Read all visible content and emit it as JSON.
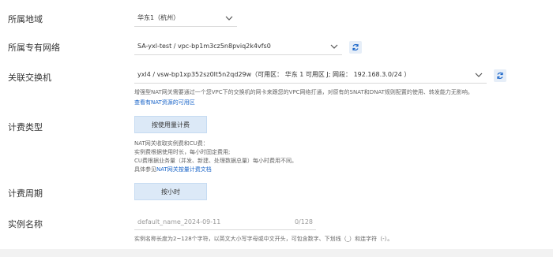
{
  "region": {
    "label": "所属地域",
    "value": "华东1（杭州）"
  },
  "vpc": {
    "label": "所属专有网络",
    "value": "SA-yxl-test / vpc-bp1m3cz5n8pviq2k4vfs0"
  },
  "vswitch": {
    "label": "关联交换机",
    "value": "yxl4 / vsw-bp1xp352sz0lt5n2qd29w（可用区： 华东 1 可用区 J; 网段： 192.168.3.0/24 ）",
    "help_line1": "增强型NAT网关需要通过一个您VPC下的交换机的网卡来跟您的VPC网络打通，对原有的SNAT和DNAT规则配置的使用、转发能力无影响。",
    "help_link": "查看有NAT资源的可用区"
  },
  "billing_type": {
    "label": "计费类型",
    "button": "按使用量计费",
    "help_line1": "NAT网关收取实例费和CU费：",
    "help_line2": "实例费根据使用时长，每小时固定费用;",
    "help_line3": "CU费根据业务量（并发、新建、处理数据总量）每小时费用不同。",
    "help_line4_prefix": "具体参见",
    "help_line4_link": "NAT网关按量计费文档"
  },
  "billing_period": {
    "label": "计费周期",
    "button": "按小时"
  },
  "instance_name": {
    "label": "实例名称",
    "placeholder": "default_name_2024-09-11",
    "counter": "0/128",
    "help": "实例名称长度为2~128个字符，以英文大小写字母或中文开头，可包含数字、下划线（_）和连字符（-）。"
  },
  "icons": {
    "chevron": "chevron-down-icon",
    "refresh": "refresh-icon"
  },
  "colors": {
    "link": "#1b66c9",
    "button_bg": "#dce9f7"
  }
}
